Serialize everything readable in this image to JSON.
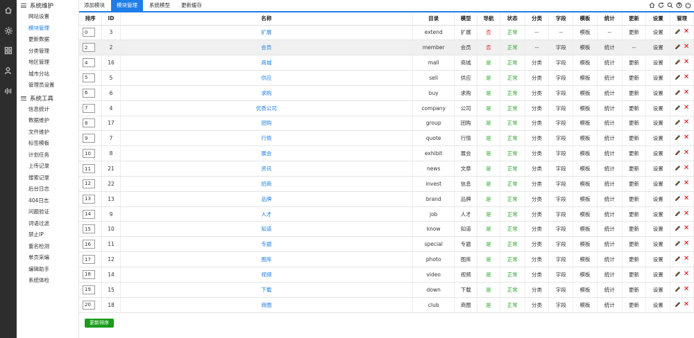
{
  "iconbar": {
    "icons": [
      "home-icon",
      "gear-icon",
      "grid-icon",
      "user-icon",
      "stats-icon"
    ]
  },
  "sidebar": {
    "groups": [
      {
        "title": "系统维护",
        "items": [
          "网站设置",
          "模块管理",
          "更新数据",
          "分类管理",
          "地区管理",
          "城市分站",
          "管理员设置"
        ]
      },
      {
        "title": "系统工具",
        "items": [
          "信息统计",
          "数据维护",
          "文件维护",
          "标签模板",
          "计划任务",
          "上传记录",
          "搜索记录",
          "后台日志",
          "404日志",
          "问题验证",
          "词语过滤",
          "禁止IP",
          "重名检测",
          "单页采编",
          "编辑助手",
          "系统体检"
        ]
      }
    ],
    "active": "模块管理"
  },
  "tabs": [
    "添加模块",
    "模块管理",
    "系统模型",
    "更新缓存"
  ],
  "active_tab": "模块管理",
  "top_icons": [
    "home-icon",
    "refresh-icon",
    "search-icon",
    "help-icon",
    "logout-icon"
  ],
  "table": {
    "headers": [
      "排序",
      "ID",
      "名称",
      "目录",
      "模型",
      "导航",
      "状态",
      "分类",
      "字段",
      "模板",
      "统计",
      "更新",
      "设置",
      "管理"
    ],
    "rows": [
      {
        "ord": "0",
        "id": "3",
        "name": "扩展",
        "dir": "extend",
        "model": "扩展",
        "nav": "否",
        "status": "正常",
        "cat": "--",
        "field": "--",
        "tpl": "模板",
        "stat": "--",
        "upd": "更新",
        "set": "设置",
        "hl": false
      },
      {
        "ord": "2",
        "id": "2",
        "name": "会员",
        "dir": "member",
        "model": "会员",
        "nav": "否",
        "status": "正常",
        "cat": "--",
        "field": "字段",
        "tpl": "模板",
        "stat": "统计",
        "upd": "--",
        "set": "设置",
        "hl": true
      },
      {
        "ord": "4",
        "id": "16",
        "name": "商城",
        "dir": "mall",
        "model": "商城",
        "nav": "是",
        "status": "正常",
        "cat": "分类",
        "field": "字段",
        "tpl": "模板",
        "stat": "统计",
        "upd": "更新",
        "set": "设置",
        "hl": false
      },
      {
        "ord": "5",
        "id": "5",
        "name": "供应",
        "dir": "sell",
        "model": "供应",
        "nav": "是",
        "status": "正常",
        "cat": "分类",
        "field": "字段",
        "tpl": "模板",
        "stat": "统计",
        "upd": "更新",
        "set": "设置",
        "hl": false
      },
      {
        "ord": "6",
        "id": "6",
        "name": "求购",
        "dir": "buy",
        "model": "求购",
        "nav": "是",
        "status": "正常",
        "cat": "分类",
        "field": "字段",
        "tpl": "模板",
        "stat": "统计",
        "upd": "更新",
        "set": "设置",
        "hl": false
      },
      {
        "ord": "7",
        "id": "4",
        "name": "优质公司",
        "dir": "company",
        "model": "公司",
        "nav": "是",
        "status": "正常",
        "cat": "分类",
        "field": "字段",
        "tpl": "模板",
        "stat": "统计",
        "upd": "更新",
        "set": "设置",
        "hl": false
      },
      {
        "ord": "8",
        "id": "17",
        "name": "团购",
        "dir": "group",
        "model": "团购",
        "nav": "是",
        "status": "正常",
        "cat": "分类",
        "field": "字段",
        "tpl": "模板",
        "stat": "统计",
        "upd": "更新",
        "set": "设置",
        "hl": false
      },
      {
        "ord": "9",
        "id": "7",
        "name": "行情",
        "dir": "quote",
        "model": "行情",
        "nav": "是",
        "status": "正常",
        "cat": "分类",
        "field": "字段",
        "tpl": "模板",
        "stat": "统计",
        "upd": "更新",
        "set": "设置",
        "hl": false
      },
      {
        "ord": "10",
        "id": "8",
        "name": "展会",
        "dir": "exhibit",
        "model": "展会",
        "nav": "是",
        "status": "正常",
        "cat": "分类",
        "field": "字段",
        "tpl": "模板",
        "stat": "统计",
        "upd": "更新",
        "set": "设置",
        "hl": false
      },
      {
        "ord": "11",
        "id": "21",
        "name": "资讯",
        "dir": "news",
        "model": "文章",
        "nav": "是",
        "status": "正常",
        "cat": "分类",
        "field": "字段",
        "tpl": "模板",
        "stat": "统计",
        "upd": "更新",
        "set": "设置",
        "hl": false
      },
      {
        "ord": "12",
        "id": "22",
        "name": "招商",
        "dir": "invest",
        "model": "信息",
        "nav": "是",
        "status": "正常",
        "cat": "分类",
        "field": "字段",
        "tpl": "模板",
        "stat": "统计",
        "upd": "更新",
        "set": "设置",
        "hl": false
      },
      {
        "ord": "13",
        "id": "13",
        "name": "品牌",
        "dir": "brand",
        "model": "品牌",
        "nav": "是",
        "status": "正常",
        "cat": "分类",
        "field": "字段",
        "tpl": "模板",
        "stat": "统计",
        "upd": "更新",
        "set": "设置",
        "hl": false
      },
      {
        "ord": "14",
        "id": "9",
        "name": "人才",
        "dir": "job",
        "model": "人才",
        "nav": "是",
        "status": "正常",
        "cat": "分类",
        "field": "字段",
        "tpl": "模板",
        "stat": "统计",
        "upd": "更新",
        "set": "设置",
        "hl": false
      },
      {
        "ord": "15",
        "id": "10",
        "name": "知道",
        "dir": "know",
        "model": "知道",
        "nav": "是",
        "status": "正常",
        "cat": "分类",
        "field": "字段",
        "tpl": "模板",
        "stat": "统计",
        "upd": "更新",
        "set": "设置",
        "hl": false
      },
      {
        "ord": "16",
        "id": "11",
        "name": "专题",
        "dir": "special",
        "model": "专题",
        "nav": "是",
        "status": "正常",
        "cat": "分类",
        "field": "字段",
        "tpl": "模板",
        "stat": "统计",
        "upd": "更新",
        "set": "设置",
        "hl": false
      },
      {
        "ord": "17",
        "id": "12",
        "name": "图库",
        "dir": "photo",
        "model": "图库",
        "nav": "是",
        "status": "正常",
        "cat": "分类",
        "field": "字段",
        "tpl": "模板",
        "stat": "统计",
        "upd": "更新",
        "set": "设置",
        "hl": false
      },
      {
        "ord": "18",
        "id": "14",
        "name": "视频",
        "dir": "video",
        "model": "视频",
        "nav": "是",
        "status": "正常",
        "cat": "分类",
        "field": "字段",
        "tpl": "模板",
        "stat": "统计",
        "upd": "更新",
        "set": "设置",
        "hl": false
      },
      {
        "ord": "19",
        "id": "15",
        "name": "下载",
        "dir": "down",
        "model": "下载",
        "nav": "是",
        "status": "正常",
        "cat": "分类",
        "field": "字段",
        "tpl": "模板",
        "stat": "统计",
        "upd": "更新",
        "set": "设置",
        "hl": false
      },
      {
        "ord": "20",
        "id": "18",
        "name": "商圈",
        "dir": "club",
        "model": "商圈",
        "nav": "是",
        "status": "正常",
        "cat": "分类",
        "field": "字段",
        "tpl": "模板",
        "stat": "统计",
        "upd": "更新",
        "set": "设置",
        "hl": false
      }
    ]
  },
  "update_order_button": "更新排序",
  "colors": {
    "accent": "#1e7ee8",
    "green": "#2aa52a",
    "red": "#e02020",
    "button": "#1a9c1a",
    "iconbar": "#2d2d2d"
  }
}
